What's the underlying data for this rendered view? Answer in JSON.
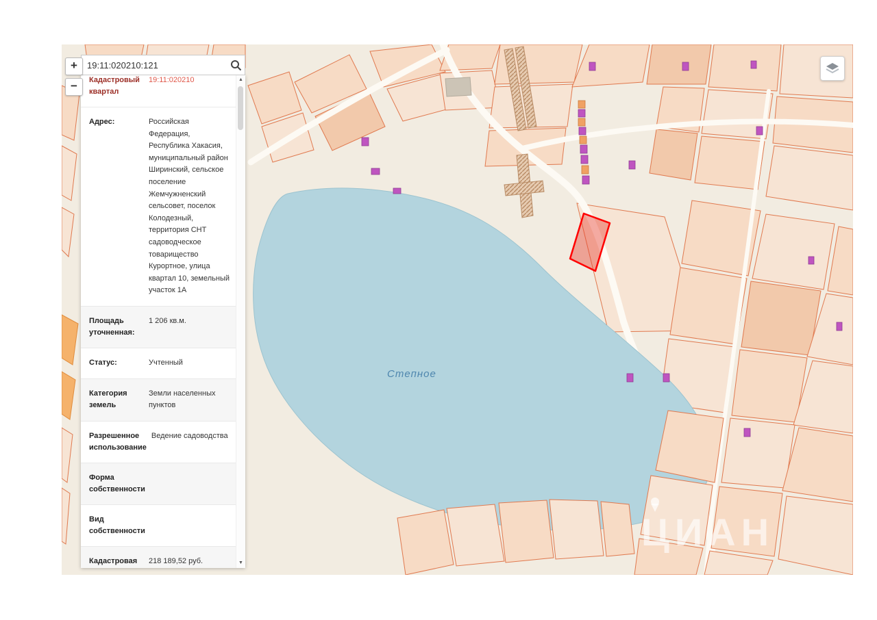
{
  "search": {
    "value": "19:11:020210:121"
  },
  "zoom_controls": {
    "zoom_in_label": "+",
    "zoom_out_label": "−"
  },
  "icons": {
    "search": "magnifier",
    "layers": "layer-stack",
    "scroll_up": "▲",
    "scroll_down": "▼",
    "watermark_pin": "map-pin"
  },
  "panel": {
    "rows": [
      {
        "label": "Кадастровый квартал",
        "value": "19:11:020210"
      },
      {
        "label": "Адрес:",
        "value": "Российская Федерация, Республика Хакасия, муниципальный район Ширинский, сельское поселение Жемчужненский сельсовет, поселок Колодезный, территория СНТ садоводческое товарищество Курортное, улица квартал 10, земельный участок 1А"
      },
      {
        "label": "Площадь уточненная:",
        "value": "1 206 кв.м."
      },
      {
        "label": "Статус:",
        "value": "Учтенный"
      },
      {
        "label": "Категория земель",
        "value": "Земли населенных пунктов"
      },
      {
        "label": "Разрешенное использование",
        "value": "Ведение садоводства"
      },
      {
        "label": "Форма собственности",
        "value": ""
      },
      {
        "label": "Вид собственности",
        "value": ""
      },
      {
        "label": "Кадастровая стоимость",
        "value": "218 189,52 руб."
      }
    ]
  },
  "map": {
    "lake_label": "Степное",
    "watermark": "ЦИАН"
  },
  "colors": {
    "map_background": "#f2ece1",
    "parcel_fill": "#f7dbc5",
    "parcel_stroke": "#e0794f",
    "water": "#b3d4de",
    "selected_parcel_stroke": "#ff0000",
    "selected_parcel_fill": "rgba(231,60,45,0.42)",
    "building_purple": "#bf55c0",
    "building_orange": "#f0a163",
    "panel_highlight_red": "#e0584a"
  }
}
